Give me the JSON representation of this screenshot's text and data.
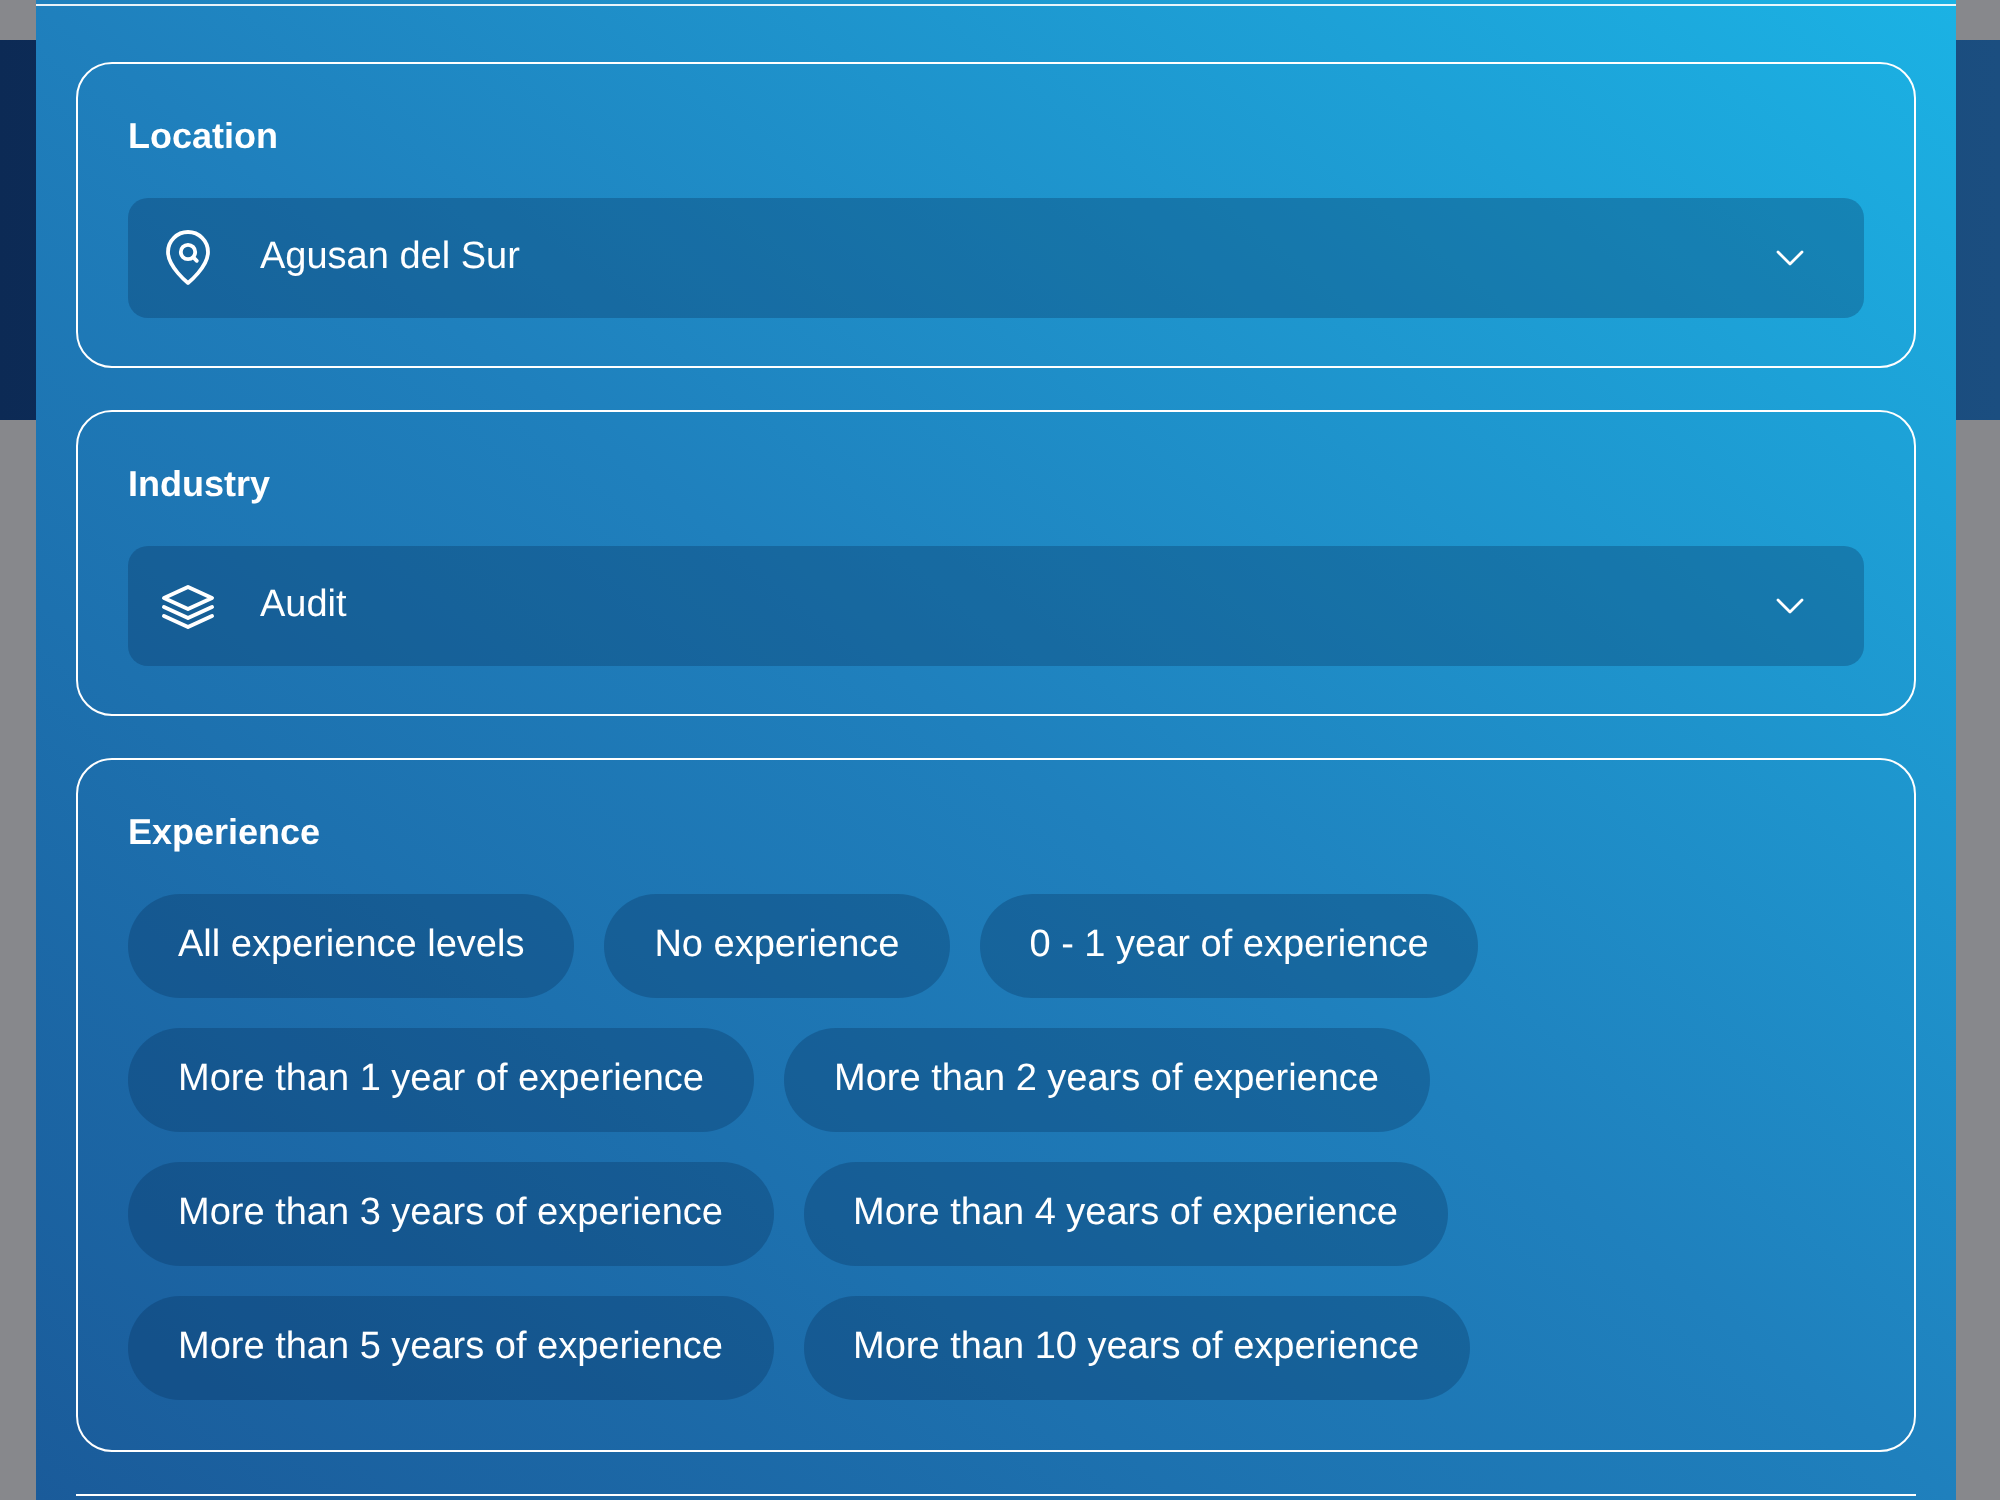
{
  "location": {
    "label": "Location",
    "value": "Agusan del Sur"
  },
  "industry": {
    "label": "Industry",
    "value": "Audit"
  },
  "experience": {
    "label": "Experience",
    "options": [
      {
        "label": "All experience levels",
        "selected": false
      },
      {
        "label": "No experience",
        "selected": false
      },
      {
        "label": "0 - 1 year of experience",
        "selected": false
      },
      {
        "label": "More than 1 year of experience",
        "selected": false
      },
      {
        "label": "More than 2 years of experience",
        "selected": false
      },
      {
        "label": "More than 3 years of experience",
        "selected": false
      },
      {
        "label": "More than 4 years of experience",
        "selected": false
      },
      {
        "label": "More than 5 years of experience",
        "selected": false
      },
      {
        "label": "More than 10 years of experience",
        "selected": false
      }
    ]
  }
}
